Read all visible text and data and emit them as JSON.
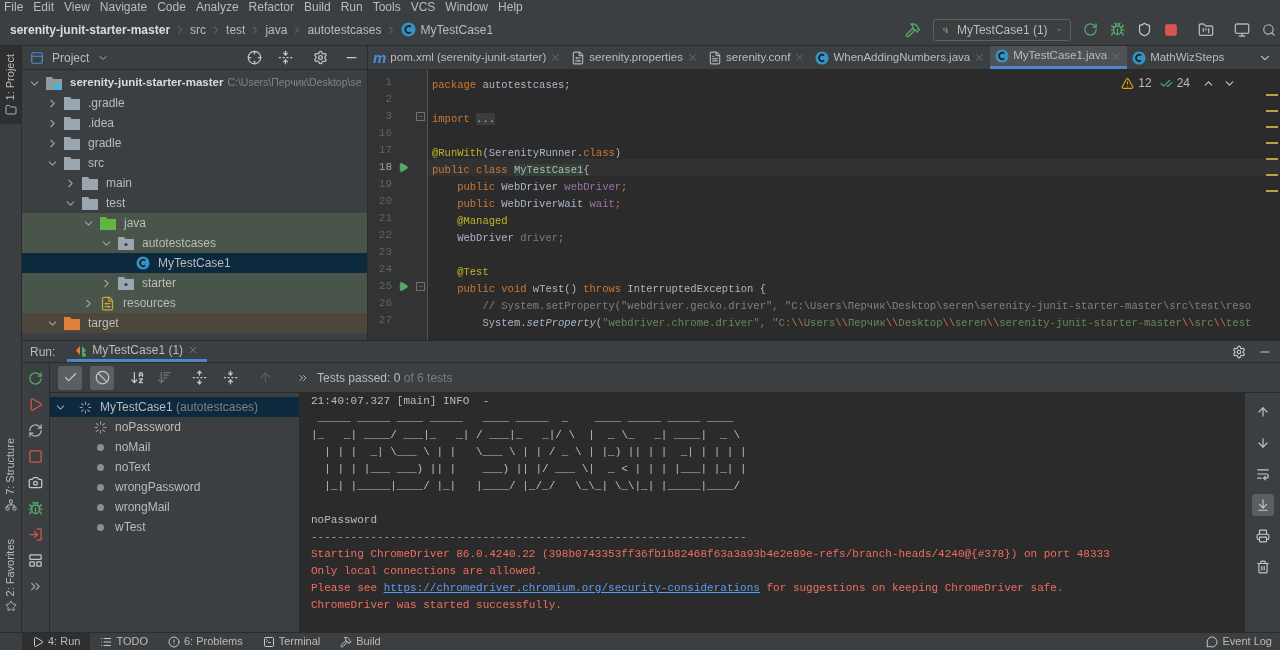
{
  "menu": [
    "File",
    "Edit",
    "View",
    "Navigate",
    "Code",
    "Analyze",
    "Refactor",
    "Build",
    "Run",
    "Tools",
    "VCS",
    "Window",
    "Help"
  ],
  "breadcrumbs": [
    {
      "label": "serenity-junit-starter-master",
      "kind": "project"
    },
    {
      "label": "src",
      "kind": "folder"
    },
    {
      "label": "test",
      "kind": "folder"
    },
    {
      "label": "java",
      "kind": "folder"
    },
    {
      "label": "autotestcases",
      "kind": "folder"
    },
    {
      "label": "MyTestCase1",
      "kind": "class"
    }
  ],
  "run_config": "MyTestCase1 (1)",
  "side_tabs": [
    {
      "label": "1: Project",
      "kind": "project",
      "selected": true
    },
    {
      "label": "7: Structure",
      "kind": "structure",
      "selected": false
    },
    {
      "label": "2: Favorites",
      "kind": "favorites",
      "selected": false
    }
  ],
  "project_panel": {
    "title": "Project",
    "tree": [
      {
        "label": "serenity-junit-starter-master",
        "path": "C:\\Users\\Перчик\\Desktop\\se",
        "kind": "module",
        "expanded": true,
        "selected": false,
        "children": [
          {
            "label": ".gradle",
            "kind": "folder",
            "expanded": false,
            "selected": false
          },
          {
            "label": ".idea",
            "kind": "folder",
            "expanded": false,
            "selected": false
          },
          {
            "label": "gradle",
            "kind": "folder",
            "expanded": false,
            "selected": false
          },
          {
            "label": "src",
            "kind": "folder",
            "expanded": true,
            "selected": false,
            "children": [
              {
                "label": "main",
                "kind": "folder",
                "expanded": false,
                "selected": false
              },
              {
                "label": "test",
                "kind": "folder",
                "expanded": true,
                "selected": false,
                "children": [
                  {
                    "label": "java",
                    "kind": "test-root",
                    "test_source": true,
                    "expanded": true,
                    "selected": false,
                    "children": [
                      {
                        "label": "autotestcases",
                        "kind": "package",
                        "test_source": true,
                        "expanded": true,
                        "selected": false,
                        "children": [
                          {
                            "label": "MyTestCase1",
                            "kind": "class",
                            "selected": true
                          }
                        ]
                      },
                      {
                        "label": "starter",
                        "kind": "package",
                        "test_source": true,
                        "expanded": false,
                        "selected": false
                      }
                    ]
                  },
                  {
                    "label": "resources",
                    "kind": "resources",
                    "test_source": true,
                    "expanded": false,
                    "selected": false
                  }
                ]
              }
            ]
          },
          {
            "label": "target",
            "kind": "excluded",
            "expanded": true,
            "selected": false
          }
        ]
      }
    ]
  },
  "editor_tabs": [
    {
      "label": "pom.xml (serenity-junit-starter)",
      "kind": "maven",
      "glyph": "m",
      "selected": false,
      "closable": true
    },
    {
      "label": "serenity.properties",
      "kind": "properties",
      "selected": false,
      "closable": true
    },
    {
      "label": "serenity.conf",
      "kind": "file",
      "selected": false,
      "closable": true
    },
    {
      "label": "WhenAddingNumbers.java",
      "kind": "class",
      "selected": false,
      "closable": true
    },
    {
      "label": "MyTestCase1.java",
      "kind": "class",
      "selected": true,
      "closable": true
    },
    {
      "label": "MathWizSteps",
      "kind": "class",
      "selected": false,
      "closable": false
    }
  ],
  "inspections": {
    "warnings": "12",
    "checks": "24"
  },
  "code_lines": [
    {
      "number": "1",
      "segments": [
        {
          "t": "package",
          "kind": "keyword"
        },
        {
          "t": " autotestcases;",
          "kind": "plain"
        }
      ]
    },
    {
      "number": "2"
    },
    {
      "number": "3",
      "fold": true,
      "segments": [
        {
          "t": "import ",
          "kind": "keyword"
        },
        {
          "t": "...",
          "kind": "fold"
        }
      ]
    },
    {
      "number": "16"
    },
    {
      "number": "17",
      "segments": [
        {
          "t": "@RunWith",
          "kind": "annotation"
        },
        {
          "t": "(SerenityRunner.",
          "kind": "plain"
        },
        {
          "t": "class",
          "kind": "keyword"
        },
        {
          "t": ")",
          "kind": "plain"
        }
      ]
    },
    {
      "number": "18",
      "run": true,
      "current": true,
      "segments": [
        {
          "t": "public class ",
          "kind": "keyword"
        },
        {
          "t": "MyTestCase1",
          "kind": "highlight"
        },
        {
          "t": "{",
          "kind": "plain"
        }
      ]
    },
    {
      "number": "19",
      "segments": [
        {
          "t": "    public ",
          "kind": "keyword"
        },
        {
          "t": "WebDriver ",
          "kind": "plain"
        },
        {
          "t": "webDriver",
          "kind": "field"
        },
        {
          "t": ";",
          "kind": "keyword"
        }
      ]
    },
    {
      "number": "20",
      "segments": [
        {
          "t": "    public ",
          "kind": "keyword"
        },
        {
          "t": "WebDriverWait ",
          "kind": "plain"
        },
        {
          "t": "wait",
          "kind": "field"
        },
        {
          "t": ";",
          "kind": "keyword"
        }
      ]
    },
    {
      "number": "21",
      "segments": [
        {
          "t": "    @Managed",
          "kind": "annotation"
        }
      ]
    },
    {
      "number": "22",
      "segments": [
        {
          "t": "    WebDriver ",
          "kind": "plain"
        },
        {
          "t": "driver",
          "kind": "unused"
        },
        {
          "t": ";",
          "kind": "keyword"
        }
      ]
    },
    {
      "number": "23"
    },
    {
      "number": "24",
      "segments": [
        {
          "t": "    @Test",
          "kind": "annotation"
        }
      ]
    },
    {
      "number": "25",
      "run": true,
      "fold": true,
      "segments": [
        {
          "t": "    public void ",
          "kind": "keyword"
        },
        {
          "t": "wTest() ",
          "kind": "plain"
        },
        {
          "t": "throws ",
          "kind": "keyword"
        },
        {
          "t": "InterruptedException {",
          "kind": "plain"
        }
      ]
    },
    {
      "number": "26",
      "segments": [
        {
          "t": "        // System.setProperty(\"webdriver.gecko.driver\", \"C:\\Users\\Перчик\\Desktop\\seren\\serenity-junit-starter-master\\src\\test\\reso",
          "kind": "comment"
        }
      ]
    },
    {
      "number": "27",
      "segments": [
        {
          "t": "        System.",
          "kind": "plain"
        },
        {
          "t": "setProperty",
          "kind": "static"
        },
        {
          "t": "(",
          "kind": "plain"
        },
        {
          "t": "\"webdriver.chrome.driver\"",
          "kind": "string"
        },
        {
          "t": ", ",
          "kind": "keyword"
        },
        {
          "t": "\"C:",
          "kind": "string"
        },
        {
          "t": "\\\\",
          "kind": "keyword"
        },
        {
          "t": "Users",
          "kind": "string"
        },
        {
          "t": "\\\\",
          "kind": "keyword"
        },
        {
          "t": "Перчик",
          "kind": "string"
        },
        {
          "t": "\\\\",
          "kind": "keyword"
        },
        {
          "t": "Desktop",
          "kind": "string"
        },
        {
          "t": "\\\\",
          "kind": "keyword"
        },
        {
          "t": "seren",
          "kind": "string"
        },
        {
          "t": "\\\\",
          "kind": "keyword"
        },
        {
          "t": "serenity-junit-starter-master",
          "kind": "string"
        },
        {
          "t": "\\\\",
          "kind": "keyword"
        },
        {
          "t": "src",
          "kind": "string"
        },
        {
          "t": "\\\\",
          "kind": "keyword"
        },
        {
          "t": "test",
          "kind": "string"
        }
      ]
    }
  ],
  "run_panel": {
    "label": "Run:",
    "tab": "MyTestCase1 (1)",
    "side_tools": [
      {
        "kind": "rerun"
      },
      {
        "kind": "rerun-failed"
      },
      {
        "kind": "toggle-auto"
      },
      {
        "kind": "stop"
      },
      {
        "kind": "camera"
      },
      {
        "kind": "debug"
      },
      {
        "kind": "exit"
      },
      {
        "kind": "layout"
      },
      {
        "kind": "more"
      }
    ],
    "toggles": [
      {
        "kind": "passed",
        "on": true
      },
      {
        "kind": "ignored",
        "on": true
      }
    ],
    "status": {
      "label": "Tests passed:",
      "passed": "0",
      "rest": "of 6 tests"
    },
    "tests": {
      "name": "MyTestCase1",
      "package": "(autotestcases)",
      "kind": "running",
      "selected": true,
      "expanded": true,
      "children": [
        {
          "name": "noPassword",
          "kind": "running",
          "selected": false
        },
        {
          "name": "noMail",
          "kind": "pending",
          "selected": false
        },
        {
          "name": "noText",
          "kind": "pending",
          "selected": false
        },
        {
          "name": "wrongPassword",
          "kind": "pending",
          "selected": false
        },
        {
          "name": "wrongMail",
          "kind": "pending",
          "selected": false
        },
        {
          "name": "wTest",
          "kind": "pending",
          "selected": false
        }
      ]
    },
    "console": [
      {
        "kind": "plain",
        "text": "21:40:07.327 [main] INFO  -"
      },
      {
        "kind": "art",
        "text": " _____ _____ ____ _____   ____ _____  _    ____ _____ _____ ____"
      },
      {
        "kind": "art",
        "text": "|_   _| ____/ ___|_   _| / ___|_   _|/ \\  |  _ \\_   _| ____|  _ \\"
      },
      {
        "kind": "art",
        "text": "  | | |  _| \\___ \\ | |   \\___ \\ | | / _ \\ | |_) || | |  _| | | | |"
      },
      {
        "kind": "art",
        "text": "  | | | |___ ___) || |    ___) || |/ ___ \\|  _ < | | | |___| |_| |"
      },
      {
        "kind": "art",
        "text": "  |_| |_____|____/ |_|   |____/ |_/_/   \\_\\_| \\_\\|_| |_____|____/"
      },
      {
        "kind": "blank"
      },
      {
        "kind": "plain",
        "text": "noPassword"
      },
      {
        "kind": "rule",
        "text": "------------------------------------------------------------------"
      },
      {
        "kind": "error",
        "text": "Starting ChromeDriver 86.0.4240.22 (398b0743353ff36fb1b82468f63a3a93b4e2e89e-refs/branch-heads/4240@{#378}) on port 48333"
      },
      {
        "kind": "error",
        "text": "Only local connections are allowed."
      },
      {
        "kind": "link",
        "before": "Please see ",
        "link": "https://chromedriver.chromium.org/security-considerations",
        "after": " for suggestions on keeping ChromeDriver safe."
      },
      {
        "kind": "error",
        "text": "ChromeDriver was started successfully."
      }
    ],
    "console_tools": [
      {
        "kind": "up",
        "on": false
      },
      {
        "kind": "down",
        "on": false
      },
      {
        "kind": "wrap",
        "on": false
      },
      {
        "kind": "scroll-end",
        "on": true
      },
      {
        "kind": "print",
        "on": false
      },
      {
        "kind": "clear",
        "on": false
      }
    ]
  },
  "bottom_tabs": [
    {
      "label": "4: Run",
      "kind": "run",
      "selected": true
    },
    {
      "label": "TODO",
      "kind": "todo",
      "selected": false
    },
    {
      "label": "6: Problems",
      "kind": "problems",
      "selected": false
    },
    {
      "label": "Terminal",
      "kind": "terminal",
      "selected": false
    },
    {
      "label": "Build",
      "kind": "build",
      "selected": false
    }
  ],
  "event_log": "Event Log"
}
